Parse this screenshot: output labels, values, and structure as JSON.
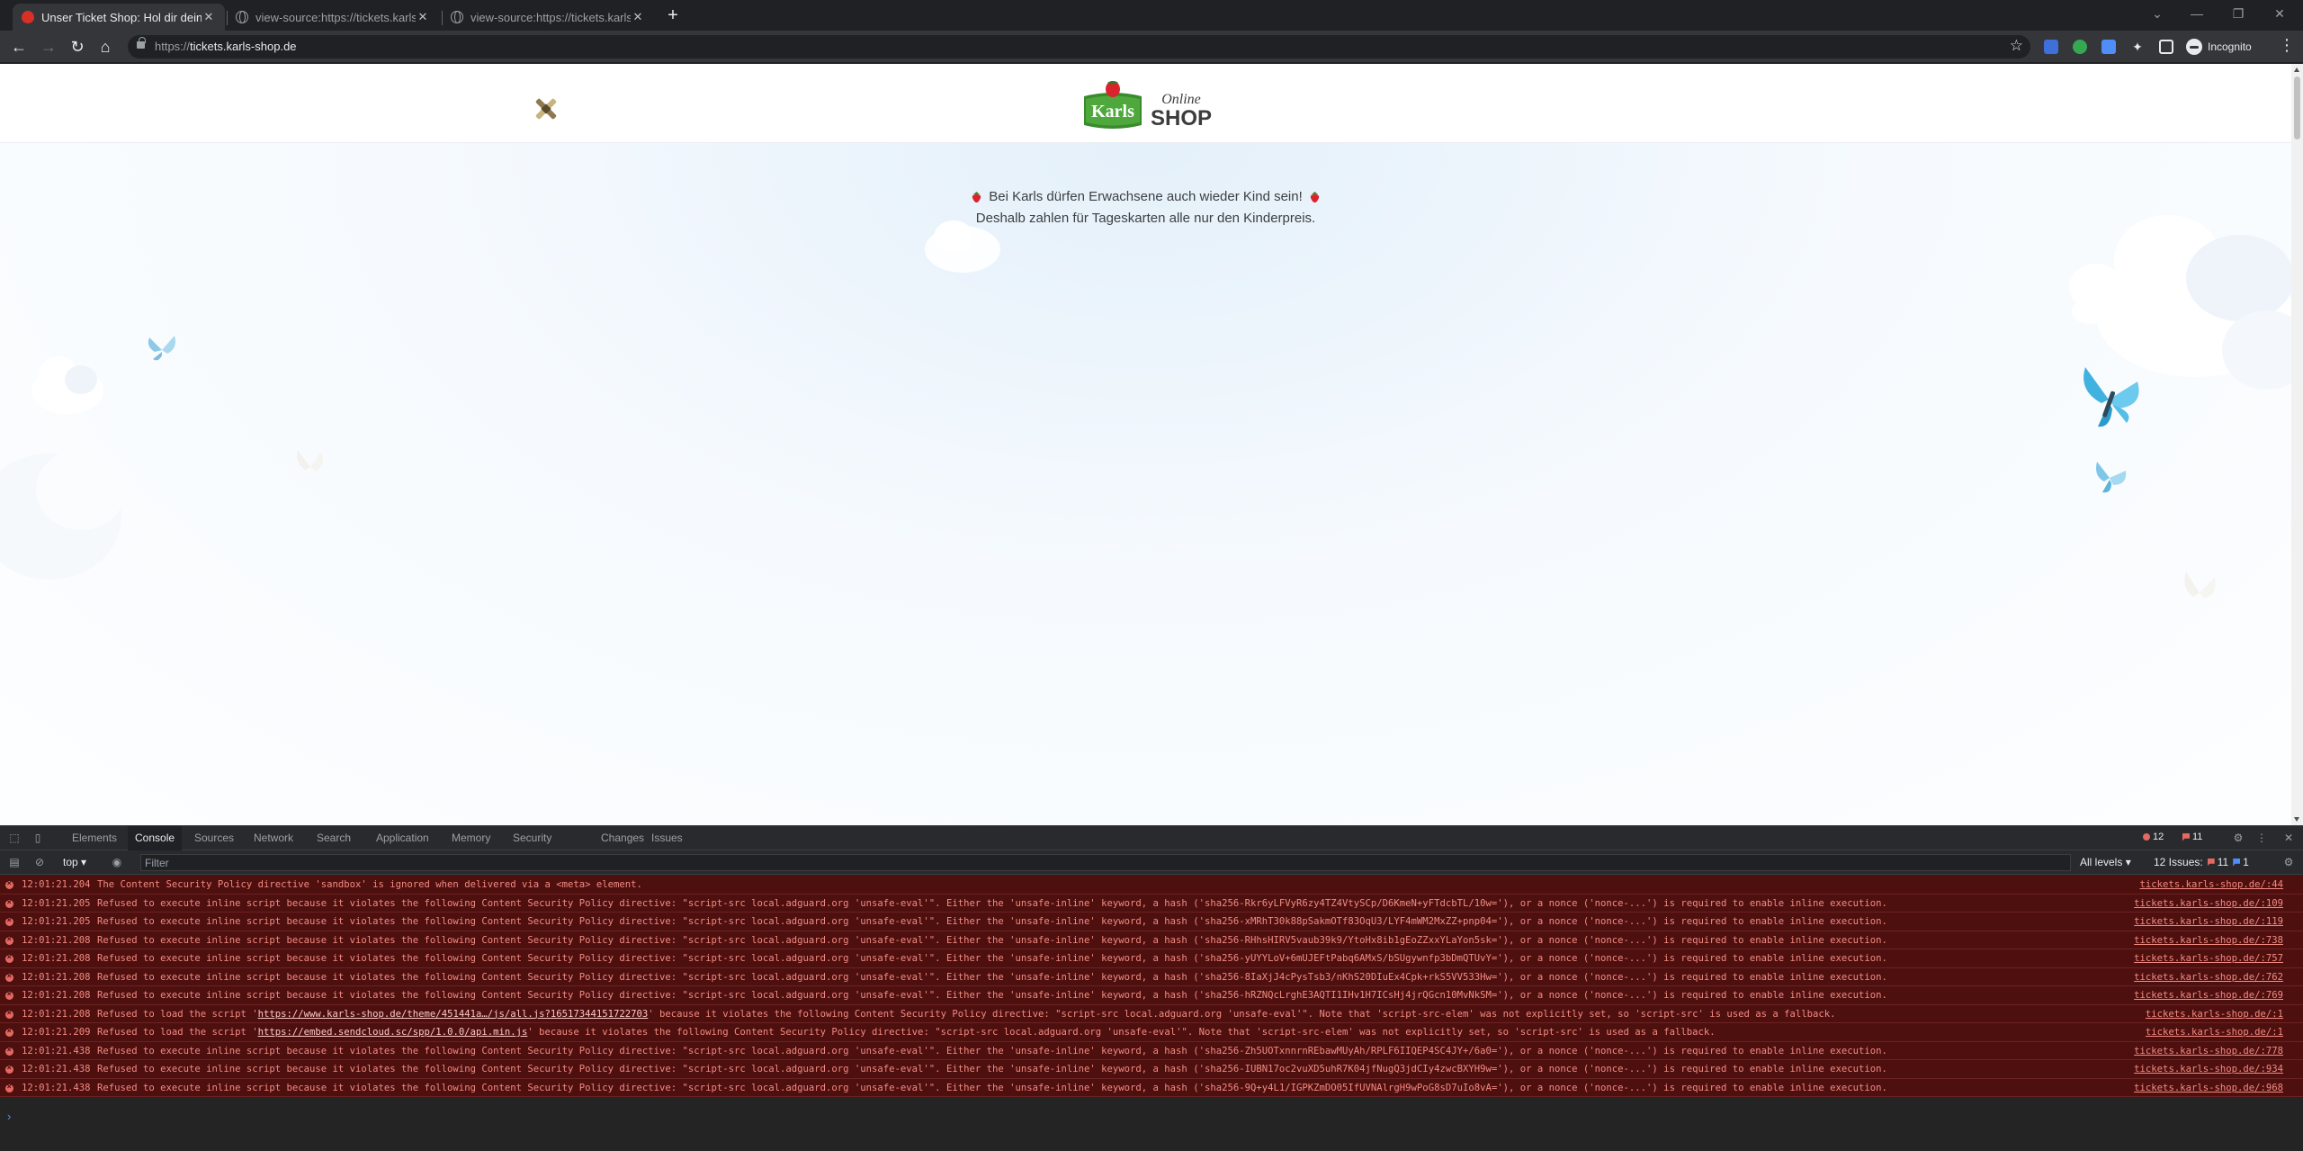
{
  "browser": {
    "tabs": [
      {
        "title": "Unser Ticket Shop: Hol dir dein T",
        "active": true,
        "favicon": "strawberry-favicon"
      },
      {
        "title": "view-source:https://tickets.karls-",
        "active": false,
        "favicon": "globe-favicon"
      },
      {
        "title": "view-source:https://tickets.karls-",
        "active": false,
        "favicon": "globe-favicon"
      }
    ],
    "new_tab": "+",
    "url_scheme": "https://",
    "url_host": "tickets.karls-shop.de",
    "profile_label": "Incognito"
  },
  "page": {
    "logo_brand": "Karls",
    "logo_online": "Online",
    "logo_shop": "SHOP",
    "tagline_1": "Bei Karls dürfen Erwachsene auch wieder Kind sein!",
    "tagline_2": "Deshalb zahlen für Tageskarten alle nur den Kinderpreis."
  },
  "devtools": {
    "tabs": [
      "Elements",
      "Console",
      "Sources",
      "Network",
      "Search",
      "Application",
      "Memory",
      "Security",
      "Changes",
      "Issues"
    ],
    "active_tab": "Console",
    "error_count": "12",
    "warning_count": "11",
    "context": "top",
    "filter_placeholder": "Filter",
    "levels_label": "All levels",
    "issues_label": "12 Issues:",
    "issues_errors": "11",
    "issues_info": "1",
    "colors": {
      "error_bg": "#4e0f0f",
      "error_text": "#f28b82"
    },
    "console_rows": [
      {
        "ts": "12:01:21.204",
        "pre": "The Content Security Policy directive 'sandbox' is ignored when delivered via a <meta> element.",
        "link": "",
        "post": "",
        "src": "tickets.karls-shop.de/:44"
      },
      {
        "ts": "12:01:21.205",
        "pre": "Refused to execute inline script because it violates the following Content Security Policy directive: \"script-src local.adguard.org 'unsafe-eval'\". Either the 'unsafe-inline' keyword, a hash ('sha256-Rkr6yLFVyR6zy4TZ4VtySCp/D6KmeN+yFTdcbTL/10w='), or a nonce ('nonce-...') is required to enable inline execution.",
        "link": "",
        "post": "",
        "src": "tickets.karls-shop.de/:109"
      },
      {
        "ts": "12:01:21.205",
        "pre": "Refused to execute inline script because it violates the following Content Security Policy directive: \"script-src local.adguard.org 'unsafe-eval'\". Either the 'unsafe-inline' keyword, a hash ('sha256-xMRhT30k88pSakmOTf83OqU3/LYF4mWM2MxZZ+pnp04='), or a nonce ('nonce-...') is required to enable inline execution.",
        "link": "",
        "post": "",
        "src": "tickets.karls-shop.de/:119"
      },
      {
        "ts": "12:01:21.208",
        "pre": "Refused to execute inline script because it violates the following Content Security Policy directive: \"script-src local.adguard.org 'unsafe-eval'\". Either the 'unsafe-inline' keyword, a hash ('sha256-RHhsHIRV5vaub39k9/YtoHx8ib1gEoZZxxYLaYon5sk='), or a nonce ('nonce-...') is required to enable inline execution.",
        "link": "",
        "post": "",
        "src": "tickets.karls-shop.de/:738"
      },
      {
        "ts": "12:01:21.208",
        "pre": "Refused to execute inline script because it violates the following Content Security Policy directive: \"script-src local.adguard.org 'unsafe-eval'\". Either the 'unsafe-inline' keyword, a hash ('sha256-yUYYLoV+6mUJEFtPabq6AMxS/bSUgywnfp3bDmQTUvY='), or a nonce ('nonce-...') is required to enable inline execution.",
        "link": "",
        "post": "",
        "src": "tickets.karls-shop.de/:757"
      },
      {
        "ts": "12:01:21.208",
        "pre": "Refused to execute inline script because it violates the following Content Security Policy directive: \"script-src local.adguard.org 'unsafe-eval'\". Either the 'unsafe-inline' keyword, a hash ('sha256-8IaXjJ4cPysTsb3/nKhS20DIuEx4Cpk+rkS5VV533Hw='), or a nonce ('nonce-...') is required to enable inline execution.",
        "link": "",
        "post": "",
        "src": "tickets.karls-shop.de/:762"
      },
      {
        "ts": "12:01:21.208",
        "pre": "Refused to execute inline script because it violates the following Content Security Policy directive: \"script-src local.adguard.org 'unsafe-eval'\". Either the 'unsafe-inline' keyword, a hash ('sha256-hRZNQcLrghE3AQTI1IHv1H7ICsHj4jrQGcn10MvNkSM='), or a nonce ('nonce-...') is required to enable inline execution.",
        "link": "",
        "post": "",
        "src": "tickets.karls-shop.de/:769"
      },
      {
        "ts": "12:01:21.208",
        "pre": "Refused to load the script '",
        "link": "https://www.karls-shop.de/theme/451441a…/js/all.js?16517344151722703",
        "post": "' because it violates the following Content Security Policy directive: \"script-src local.adguard.org 'unsafe-eval'\". Note that 'script-src-elem' was not explicitly set, so 'script-src' is used as a fallback.",
        "src": "tickets.karls-shop.de/:1"
      },
      {
        "ts": "12:01:21.209",
        "pre": "Refused to load the script '",
        "link": "https://embed.sendcloud.sc/spp/1.0.0/api.min.js",
        "post": "' because it violates the following Content Security Policy directive: \"script-src local.adguard.org 'unsafe-eval'\". Note that 'script-src-elem' was not explicitly set, so 'script-src' is used as a fallback.",
        "src": "tickets.karls-shop.de/:1"
      },
      {
        "ts": "12:01:21.438",
        "pre": "Refused to execute inline script because it violates the following Content Security Policy directive: \"script-src local.adguard.org 'unsafe-eval'\". Either the 'unsafe-inline' keyword, a hash ('sha256-Zh5UOTxnnrnREbawMUyAh/RPLF6IIQEP4SC4JY+/6a0='), or a nonce ('nonce-...') is required to enable inline execution.",
        "link": "",
        "post": "",
        "src": "tickets.karls-shop.de/:778"
      },
      {
        "ts": "12:01:21.438",
        "pre": "Refused to execute inline script because it violates the following Content Security Policy directive: \"script-src local.adguard.org 'unsafe-eval'\". Either the 'unsafe-inline' keyword, a hash ('sha256-IUBN17oc2vuXD5uhR7K04jfNugQ3jdCIy4zwcBXYH9w='), or a nonce ('nonce-...') is required to enable inline execution.",
        "link": "",
        "post": "",
        "src": "tickets.karls-shop.de/:934"
      },
      {
        "ts": "12:01:21.438",
        "pre": "Refused to execute inline script because it violates the following Content Security Policy directive: \"script-src local.adguard.org 'unsafe-eval'\". Either the 'unsafe-inline' keyword, a hash ('sha256-9Q+y4L1/IGPKZmDO05IfUVNAlrgH9wPoG8sD7uIo8vA='), or a nonce ('nonce-...') is required to enable inline execution.",
        "link": "",
        "post": "",
        "src": "tickets.karls-shop.de/:968"
      }
    ],
    "prompt": "›"
  }
}
